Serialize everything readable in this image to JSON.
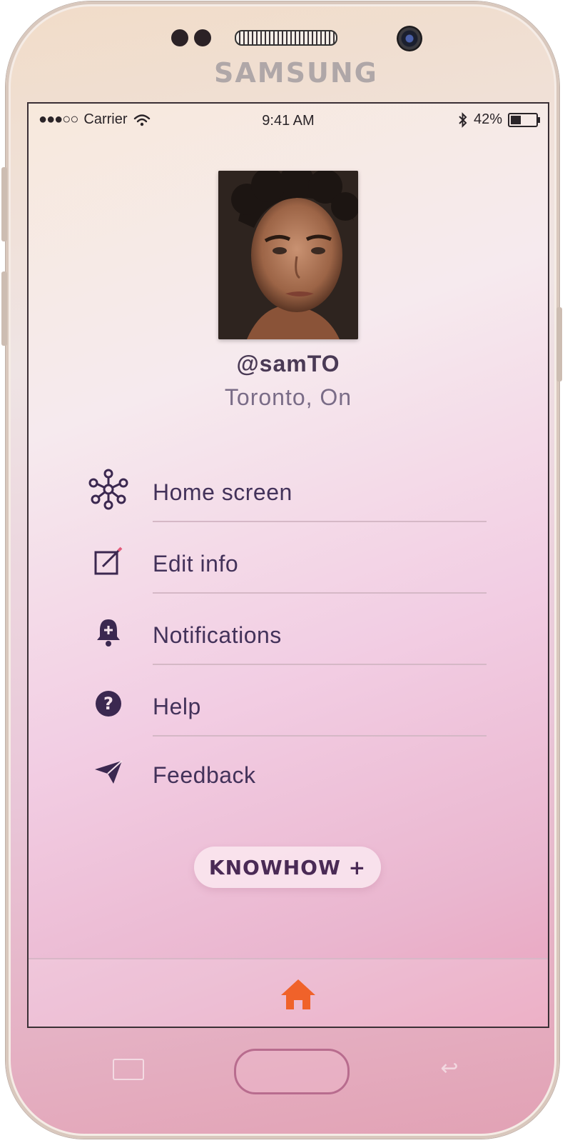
{
  "device": {
    "brand": "SAMSUNG"
  },
  "status_bar": {
    "signal": "●●●○○",
    "carrier": "Carrier",
    "time": "9:41 AM",
    "battery": "42%"
  },
  "profile": {
    "username": "@samTO",
    "location": "Toronto, On"
  },
  "menu": {
    "items": [
      {
        "label": "Home screen",
        "icon": "network-icon"
      },
      {
        "label": "Edit info",
        "icon": "edit-icon"
      },
      {
        "label": "Notifications",
        "icon": "bell-icon"
      },
      {
        "label": "Help",
        "icon": "help-icon"
      },
      {
        "label": "Feedback",
        "icon": "send-icon"
      }
    ]
  },
  "cta": {
    "label": "KNOWHOW +"
  },
  "tabbar": {
    "active_icon": "home-icon",
    "active_color": "#f0622a"
  },
  "colors": {
    "menu_text": "#43325a",
    "accent": "#f0622a"
  }
}
